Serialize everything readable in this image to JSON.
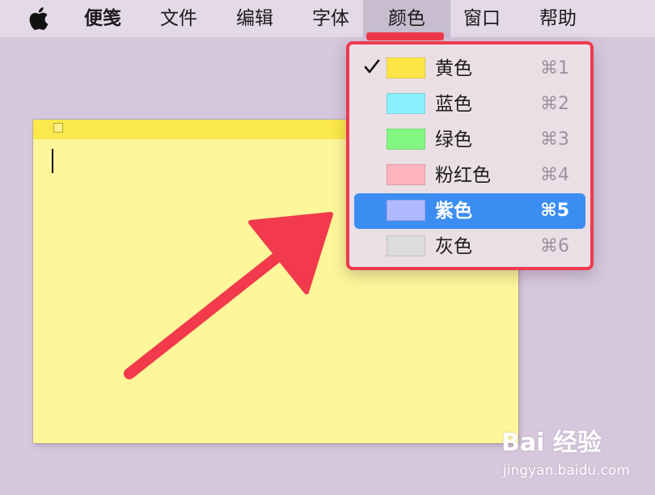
{
  "menubar": {
    "apple_icon": "apple-logo-icon",
    "app_name": "便笺",
    "items": [
      {
        "label": "文件"
      },
      {
        "label": "编辑"
      },
      {
        "label": "字体"
      },
      {
        "label": "颜色",
        "active": true
      },
      {
        "label": "窗口"
      },
      {
        "label": "帮助"
      }
    ]
  },
  "color_menu": {
    "items": [
      {
        "label": "黄色",
        "shortcut": "⌘1",
        "swatch": "#fde747",
        "checked": true
      },
      {
        "label": "蓝色",
        "shortcut": "⌘2",
        "swatch": "#8af0fb",
        "checked": false
      },
      {
        "label": "绿色",
        "shortcut": "⌘3",
        "swatch": "#82f882",
        "checked": false
      },
      {
        "label": "粉红色",
        "shortcut": "⌘4",
        "swatch": "#fdb4bf",
        "checked": false
      },
      {
        "label": "紫色",
        "shortcut": "⌘5",
        "swatch": "#b0b8ff",
        "checked": false,
        "highlighted": true
      },
      {
        "label": "灰色",
        "shortcut": "⌘6",
        "swatch": "#dcdcdc",
        "checked": false
      }
    ]
  },
  "colors": {
    "desktop": "#d6c7dc",
    "note_body": "#fdf69a",
    "note_titlebar": "#fbe84a",
    "selection": "#3b8df2",
    "annotation_red": "#f23a4c"
  },
  "watermark": {
    "logo": "Bai  经验",
    "url": "jingyan.baidu.com"
  }
}
